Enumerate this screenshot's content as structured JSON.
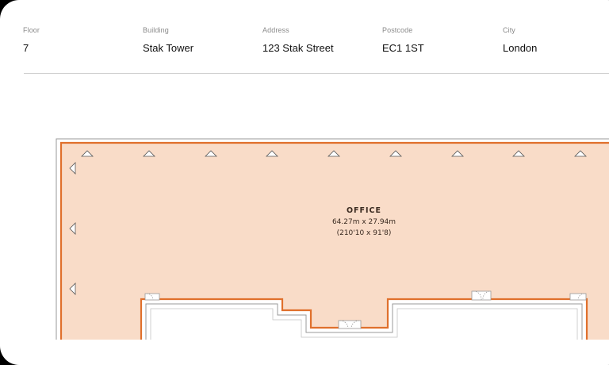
{
  "details": {
    "floor": {
      "label": "Floor",
      "value": "7"
    },
    "building": {
      "label": "Building",
      "value": "Stak Tower"
    },
    "address": {
      "label": "Address",
      "value": "123 Stak Street"
    },
    "postcode": {
      "label": "Postcode",
      "value": "EC1 1ST"
    },
    "city": {
      "label": "City",
      "value": "London"
    }
  },
  "floorplan": {
    "room_name": "OFFICE",
    "room_size_metric": "64.27m x 27.94m",
    "room_size_imperial": "(210'10 x 91'8)",
    "colors": {
      "room_fill": "#f9dcc8",
      "outline": "#e0702c",
      "wall": "#8c8c8c"
    },
    "icons": [
      "window-marker-icon",
      "door-swing-icon"
    ]
  }
}
